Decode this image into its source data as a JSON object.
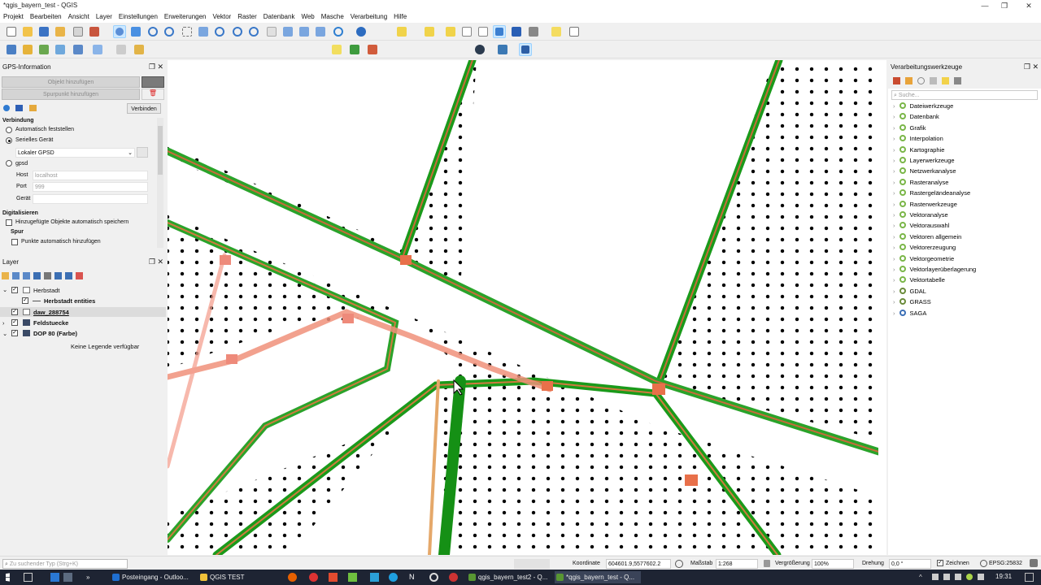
{
  "window": {
    "title": "*qgis_bayern_test - QGIS",
    "minimize": "—",
    "restore": "❐",
    "close": "✕"
  },
  "menu": [
    "Projekt",
    "Bearbeiten",
    "Ansicht",
    "Layer",
    "Einstellungen",
    "Erweiterungen",
    "Vektor",
    "Raster",
    "Datenbank",
    "Web",
    "Masche",
    "Verarbeitung",
    "Hilfe"
  ],
  "gps_panel": {
    "title": "GPS-Information",
    "add_feature": "Objekt hinzufügen",
    "add_trackpoint": "Spurpunkt hinzufügen",
    "connect": "Verbinden",
    "connection_header": "Verbindung",
    "auto_detect": "Automatisch feststellen",
    "serial_device": "Serielles Gerät",
    "device_select": "Lokaler GPSD",
    "gpsd": "gpsd",
    "host_label": "Host",
    "host_value": "localhost",
    "port_label": "Port",
    "port_value": "999",
    "device_label": "Gerät",
    "digitize_header": "Digitalisieren",
    "autosave": "Hinzugefügte Objekte automatisch speichern",
    "track_header": "Spur",
    "auto_add_points": "Punkte automatisch hinzufügen"
  },
  "layers_panel": {
    "title": "Layer",
    "items": [
      {
        "name": "Herbstadt",
        "bold": false
      },
      {
        "name": "Herbstadt entities",
        "bold": true
      },
      {
        "name": "daw_288754",
        "bold": true
      },
      {
        "name": "Feldstuecke",
        "bold": true
      },
      {
        "name": "DOP 80 (Farbe)",
        "bold": true
      }
    ],
    "no_legend": "Keine Legende verfügbar"
  },
  "processing_panel": {
    "title": "Verarbeitungswerkzeuge",
    "search_placeholder": "Suche...",
    "items": [
      "Dateiwerkzeuge",
      "Datenbank",
      "Grafik",
      "Interpolation",
      "Kartographie",
      "Layerwerkzeuge",
      "Netzwerkanalyse",
      "Rasteranalyse",
      "Rastergeländeanalyse",
      "Rasterwerkzeuge",
      "Vektoranalyse",
      "Vektorauswahl",
      "Vektoren allgemein",
      "Vektorerzeugung",
      "Vektorgeometrie",
      "Vektorlayerüberlagerung",
      "Vektortabelle",
      "GDAL",
      "GRASS",
      "SAGA"
    ]
  },
  "statusbar": {
    "search_placeholder": "Zu suchender Typ (Strg+K)",
    "coord_label": "Koordinate",
    "coord_value": "604601.9,5577602.2",
    "scale_label": "Maßstab",
    "scale_value": "1:268",
    "magnifier_label": "Vergrößerung",
    "magnifier_value": "100%",
    "rotation_label": "Drehung",
    "rotation_value": "0,0 °",
    "render_label": "Zeichnen",
    "crs": "EPSG:25832"
  },
  "taskbar": {
    "tasks": [
      "Posteingang - Outloo...",
      "QGIS TEST",
      "qgis_bayern_test2 - Q...",
      "*qgis_bayern_test - Q..."
    ],
    "time": "19:31"
  },
  "colors": {
    "accent": "#0078d7",
    "green_line": "#1a9a1a",
    "orange_line": "#e8704a"
  }
}
